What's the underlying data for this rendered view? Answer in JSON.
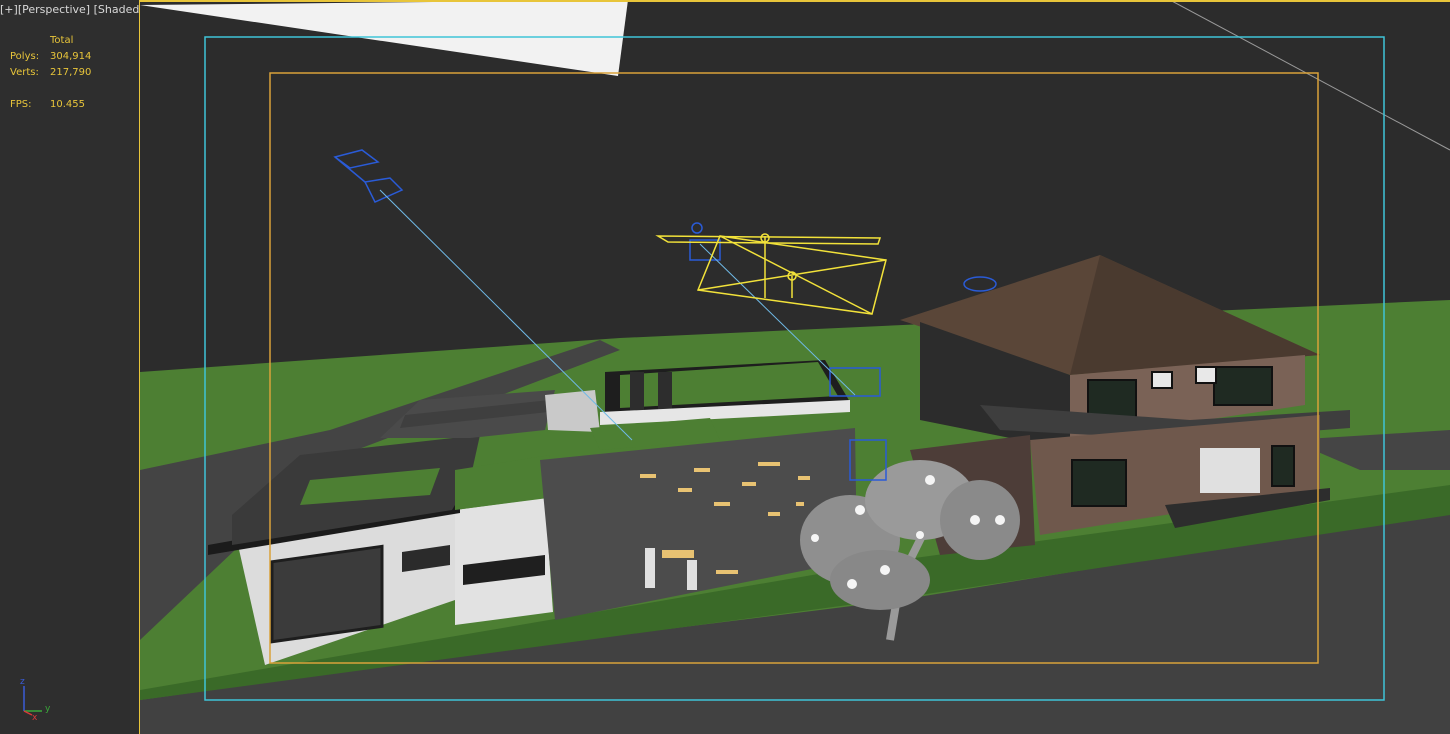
{
  "viewport": {
    "label_plus": "[+]",
    "label_view": "[Perspective]",
    "label_shading": "[Shaded]"
  },
  "stats": {
    "column_header": "Total",
    "polys_label": "Polys:",
    "polys_value": "304,914",
    "verts_label": "Verts:",
    "verts_value": "217,790",
    "fps_label": "FPS:",
    "fps_value": "10.455"
  },
  "axis": {
    "z": "z",
    "x": "x",
    "y": "y"
  },
  "colors": {
    "stats_text": "#e8c53a",
    "safe_frame_outer": "#3fc4d8",
    "safe_frame_inner": "#d9a23a",
    "camera_selected": "#f2e23a",
    "camera_other": "#2a5bd7",
    "background": "#2b2b2b",
    "grass": "#4a7a30",
    "road": "#3f3f3f"
  }
}
